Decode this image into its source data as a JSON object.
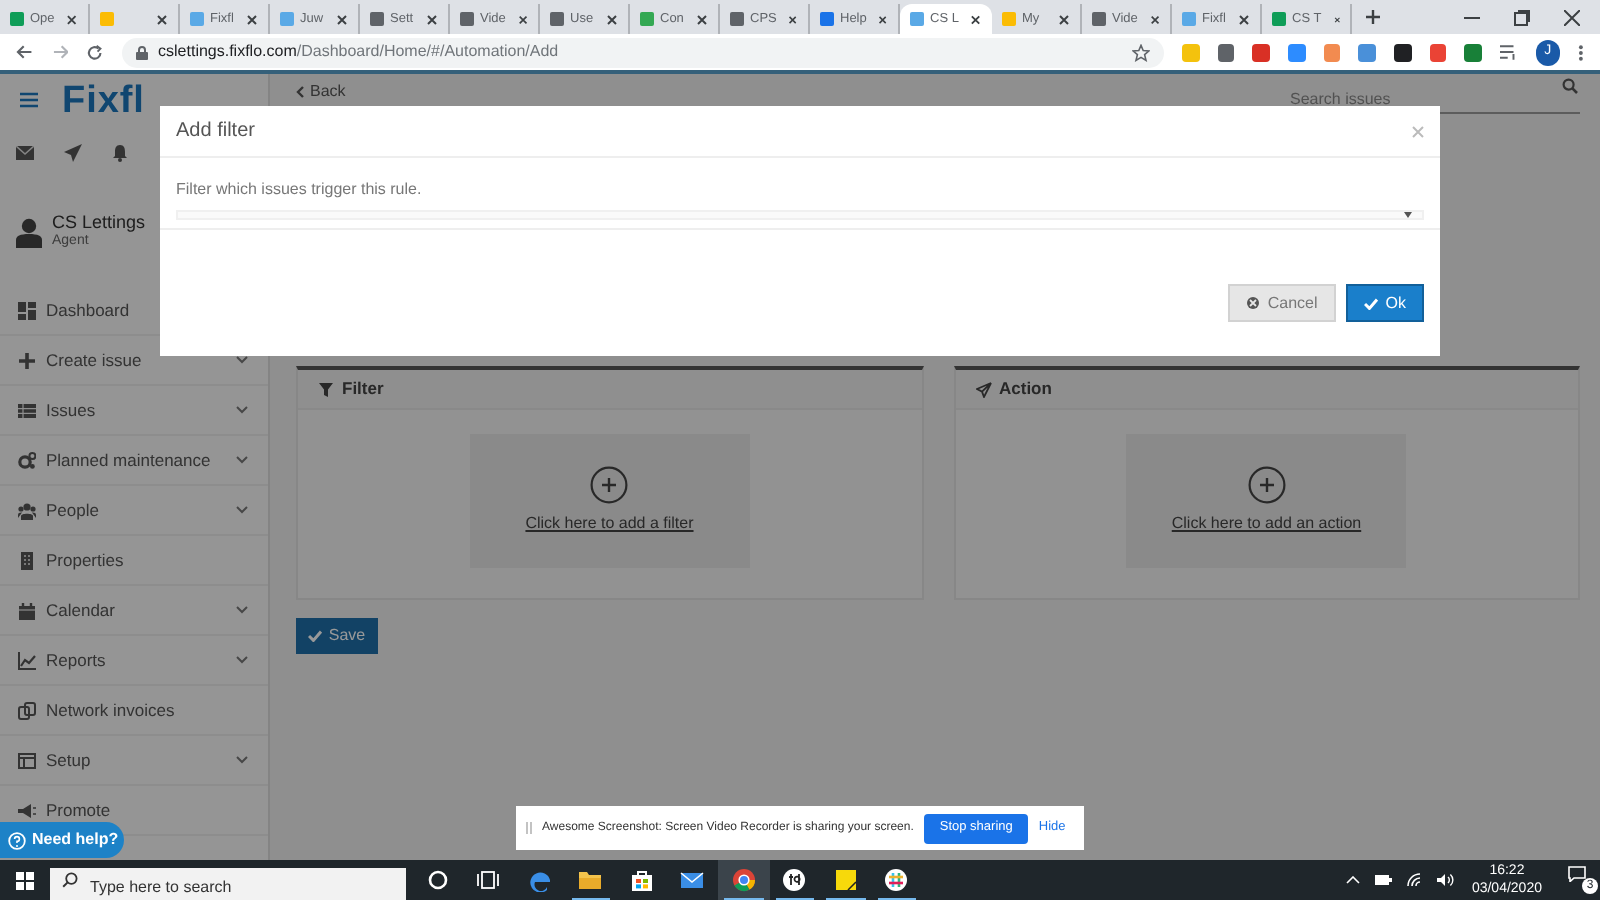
{
  "browser": {
    "tabs": [
      {
        "title": "Ope",
        "color": "#0f9d58",
        "selected": false
      },
      {
        "color": "#fbbc04",
        "selected": false
      },
      {
        "title": "Fixfl",
        "color": "#5aa9e6",
        "selected": false
      },
      {
        "title": "Juw",
        "color": "#5aa9e6",
        "selected": false
      },
      {
        "title": "Sett",
        "color": "#5f6368",
        "selected": false
      },
      {
        "title": "Vide",
        "color": "#5f6368",
        "selected": false
      },
      {
        "title": "Use",
        "color": "#5f6368",
        "selected": false
      },
      {
        "title": "Con",
        "color": "#34a853",
        "selected": false
      },
      {
        "title": "CPS",
        "color": "#5f6368",
        "selected": false
      },
      {
        "title": "Help",
        "color": "#1a73e8",
        "selected": false
      },
      {
        "title": "CS L",
        "color": "#5aa9e6",
        "selected": true
      },
      {
        "title": "My",
        "color": "#fbbc04",
        "selected": false
      },
      {
        "title": "Vide",
        "color": "#5f6368",
        "selected": false
      },
      {
        "title": "Fixfl",
        "color": "#5aa9e6",
        "selected": false
      },
      {
        "title": "CS T",
        "color": "#0f9d58",
        "selected": false
      }
    ],
    "url_host": "cslettings.fixflo.com",
    "url_path": "/Dashboard/Home/#/Automation/Add",
    "extensions": [
      {
        "color": "#f4c20d"
      },
      {
        "color": "#5f6368"
      },
      {
        "color": "#d93025"
      },
      {
        "color": "#2d8cff"
      },
      {
        "color": "#f28b50"
      },
      {
        "color": "#4a90d9"
      },
      {
        "color": "#202124"
      },
      {
        "color": "#ea4335"
      },
      {
        "color": "#188038"
      }
    ],
    "profile_initial": "J"
  },
  "app": {
    "logo": "Fixfl",
    "user": {
      "name": "CS Lettings",
      "role": "Agent"
    },
    "nav": [
      {
        "label": "Dashboard",
        "kind": "grid"
      },
      {
        "label": "Create issue",
        "kind": "plus",
        "expandable": true
      },
      {
        "label": "Issues",
        "kind": "list",
        "expandable": true
      },
      {
        "label": "Planned maintenance",
        "kind": "gear",
        "expandable": true
      },
      {
        "label": "People",
        "kind": "people",
        "expandable": true
      },
      {
        "label": "Properties",
        "kind": "building",
        "expandable": false
      },
      {
        "label": "Calendar",
        "kind": "calendar",
        "expandable": true
      },
      {
        "label": "Reports",
        "kind": "chart",
        "expandable": true
      },
      {
        "label": "Network invoices",
        "kind": "copy",
        "expandable": false
      },
      {
        "label": "Setup",
        "kind": "window",
        "expandable": true
      },
      {
        "label": "Promote",
        "kind": "megaphone",
        "expandable": false
      }
    ],
    "help_button": "Need help?",
    "back_link": "Back",
    "search": {
      "placeholder": "Search issues"
    },
    "panels": [
      {
        "title": "Filter",
        "kind": "filter",
        "add_link": "Click here to add a filter"
      },
      {
        "title": "Action",
        "kind": "action",
        "add_link": "Click here to add an action"
      }
    ],
    "save_button": "Save"
  },
  "modal": {
    "title": "Add filter",
    "description": "Filter which issues trigger this rule.",
    "buttons": [
      {
        "label": "Cancel",
        "kind": "cancel"
      },
      {
        "label": "Ok",
        "kind": "ok"
      }
    ]
  },
  "sharing_bar": {
    "message": "Awesome Screenshot: Screen Video Recorder is sharing your screen.",
    "stop_button": "Stop sharing",
    "hide_link": "Hide"
  },
  "taskbar": {
    "search_placeholder": "Type here to search",
    "apps": [
      {
        "kind": "cortana",
        "running": false,
        "selected": false
      },
      {
        "kind": "taskview",
        "running": false,
        "selected": false
      },
      {
        "kind": "edge",
        "running": false,
        "selected": false
      },
      {
        "kind": "explorer",
        "running": true,
        "selected": false
      },
      {
        "kind": "store",
        "running": false,
        "selected": false
      },
      {
        "kind": "mail",
        "running": false,
        "selected": false
      },
      {
        "kind": "chrome",
        "running": true,
        "selected": true
      },
      {
        "kind": "td",
        "running": true,
        "selected": false
      },
      {
        "kind": "sticky",
        "running": true,
        "selected": false
      },
      {
        "kind": "slack",
        "running": true,
        "selected": false
      }
    ],
    "time": "16:22",
    "date": "03/04/2020",
    "notification_count": "3"
  }
}
